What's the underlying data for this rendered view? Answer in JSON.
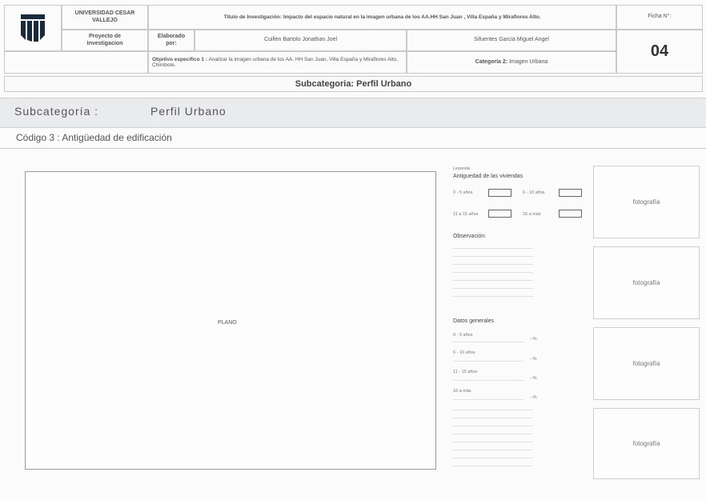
{
  "header": {
    "university": "UNIVERSIDAD CESAR VALLEJO",
    "title": "Titulo de Investigación: Impacto del espacio natural en la imagen urbana de los AA.HH San Juan , Villa España y Miraflores Alto.",
    "ficha_label": "Ficha N°:",
    "ficha_number": "04",
    "proyecto": "Proyecto de Investigacion",
    "elaborado": "Elaborado por:",
    "author1": "Cuillen Bartolo Jonathan Joel",
    "author2": "Sifuentes Garcia Miguel Angel",
    "objetivo_bold": "Objetivo específico 1 :",
    "objetivo_text": " Analizar la imagen urbana de los AA. HH San Juan, Villa España y Miraflores Alto, Chimbote.",
    "categoria_bold": "Categoría 2:",
    "categoria_text": " Imagen Urbana",
    "subcategoria_banner": "Subcategoria: Perfil Urbano"
  },
  "section": {
    "subcat_label": "Subcategoría :",
    "subcat_value": "Perfil Urbano",
    "codigo": "Código 3 : Antigüedad de edificación"
  },
  "plan": {
    "label": "PLANO"
  },
  "legend": {
    "title": "Leyenda",
    "subtitle": "Antiguedad de las viviendas",
    "items": [
      "0 - 5 años",
      "6 - 10 años",
      "11 a 15 años",
      "16 a más"
    ]
  },
  "observacion": {
    "label": "Observación:"
  },
  "datos": {
    "label": "Datos generales",
    "rows": [
      {
        "label": "0 - 5 años",
        "pct": "--%"
      },
      {
        "label": "6 - 10 años",
        "pct": "--%"
      },
      {
        "label": "11 - 15 años",
        "pct": "--%"
      },
      {
        "label": "16 a más",
        "pct": "--%"
      }
    ]
  },
  "photos": [
    "fotografía",
    "fotografía",
    "fotografía",
    "fotografía"
  ]
}
